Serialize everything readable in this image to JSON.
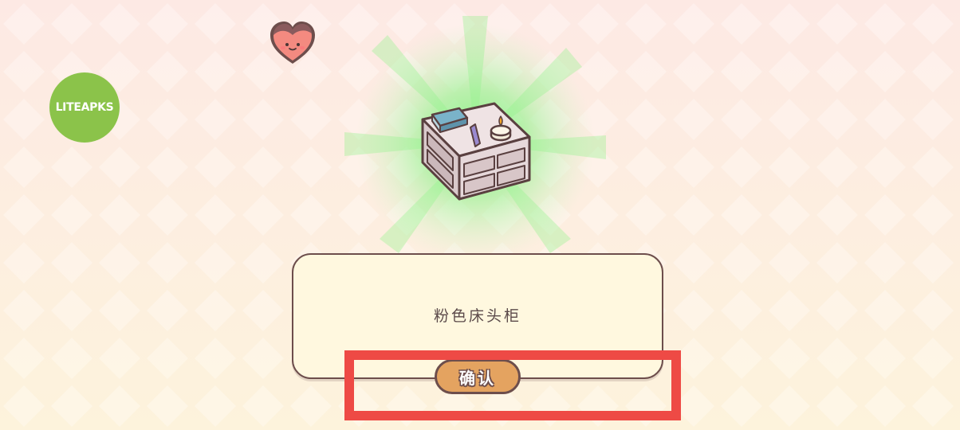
{
  "watermark": {
    "text": "LITEAPKS",
    "color": "#8bc34a"
  },
  "mascot": {
    "icon": "heart-face-icon",
    "color": "#f48a80"
  },
  "reward": {
    "icon": "nightstand-icon",
    "glow_color": "#7ef07a",
    "name": "粉色床头柜"
  },
  "dialog": {
    "background": "#fff8df",
    "border": "#6d4e4c"
  },
  "confirm_button": {
    "label": "确认",
    "color": "#e4a360"
  },
  "highlight": {
    "color": "#ee4a45"
  }
}
